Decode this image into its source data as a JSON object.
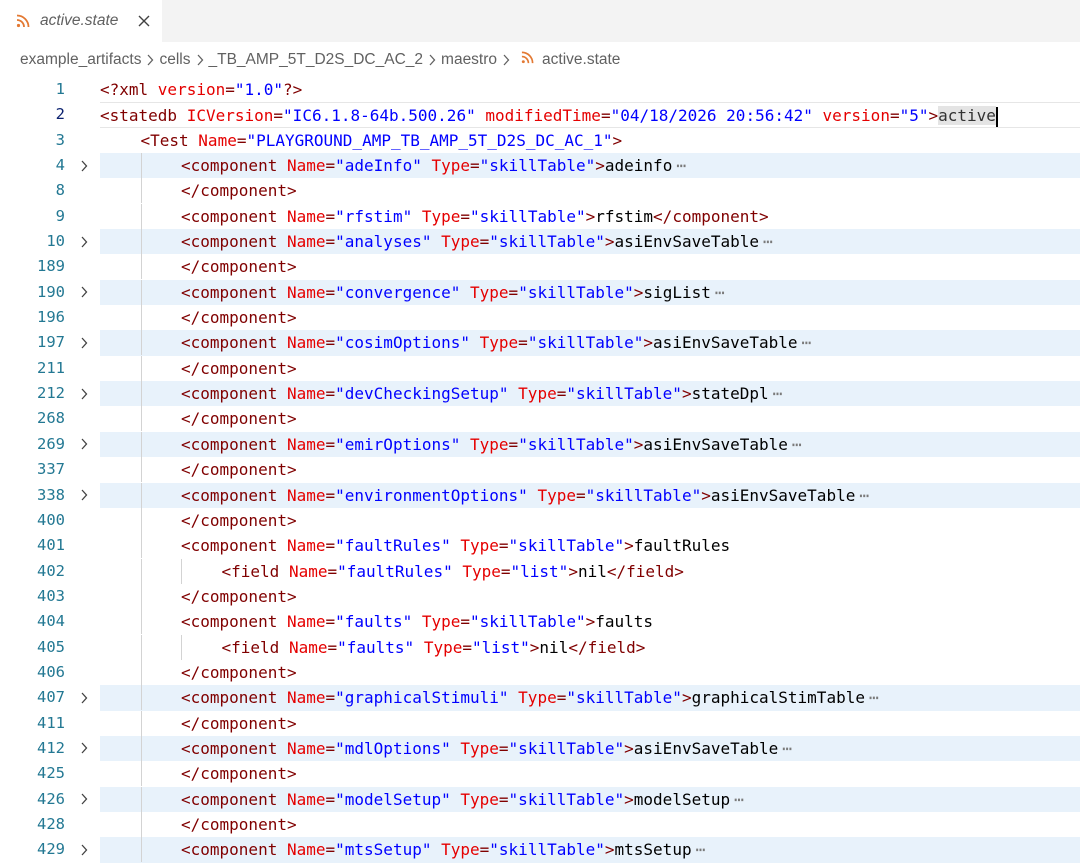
{
  "tab": {
    "title": "active.state"
  },
  "breadcrumb": [
    "example_artifacts",
    "cells",
    "_TB_AMP_5T_D2S_DC_AC_2",
    "maestro",
    "active.state"
  ],
  "colors": {
    "tag": "#800000",
    "attr": "#e50000",
    "value": "#0000ff",
    "text": "#000000",
    "line_number": "#237893",
    "rss": "#e37933"
  },
  "lines": [
    {
      "num": "1",
      "indent": 0,
      "fold": false,
      "tokens": [
        [
          "tag",
          "<?xml "
        ],
        [
          "attr",
          "version"
        ],
        [
          "tag",
          "="
        ],
        [
          "val",
          "\"1.0\""
        ],
        [
          "tag",
          "?>"
        ]
      ]
    },
    {
      "num": "2",
      "indent": 0,
      "fold": false,
      "current": true,
      "tokens": [
        [
          "tag",
          "<statedb "
        ],
        [
          "attr",
          "ICVersion"
        ],
        [
          "tag",
          "="
        ],
        [
          "val",
          "\"IC6.1.8-64b.500.26\""
        ],
        [
          "tag",
          " "
        ],
        [
          "attr",
          "modifiedTime"
        ],
        [
          "tag",
          "="
        ],
        [
          "val",
          "\"04/18/2026 20:56:42\""
        ],
        [
          "tag",
          " "
        ],
        [
          "attr",
          "version"
        ],
        [
          "tag",
          "="
        ],
        [
          "val",
          "\"5\""
        ],
        [
          "tag",
          ">"
        ],
        [
          "sel",
          "active"
        ]
      ]
    },
    {
      "num": "3",
      "indent": 1,
      "fold": false,
      "tokens": [
        [
          "tag",
          "<Test "
        ],
        [
          "attr",
          "Name"
        ],
        [
          "tag",
          "="
        ],
        [
          "val",
          "\"PLAYGROUND_AMP_TB_AMP_5T_D2S_DC_AC_1\""
        ],
        [
          "tag",
          ">"
        ]
      ]
    },
    {
      "num": "4",
      "indent": 2,
      "fold": true,
      "tokens": [
        [
          "tag",
          "<component "
        ],
        [
          "attr",
          "Name"
        ],
        [
          "tag",
          "="
        ],
        [
          "val",
          "\"adeInfo\""
        ],
        [
          "tag",
          " "
        ],
        [
          "attr",
          "Type"
        ],
        [
          "tag",
          "="
        ],
        [
          "val",
          "\"skillTable\""
        ],
        [
          "tag",
          ">"
        ],
        [
          "text",
          "adeinfo"
        ]
      ]
    },
    {
      "num": "8",
      "indent": 2,
      "fold": false,
      "tokens": [
        [
          "tag",
          "</component>"
        ]
      ]
    },
    {
      "num": "9",
      "indent": 2,
      "fold": false,
      "tokens": [
        [
          "tag",
          "<component "
        ],
        [
          "attr",
          "Name"
        ],
        [
          "tag",
          "="
        ],
        [
          "val",
          "\"rfstim\""
        ],
        [
          "tag",
          " "
        ],
        [
          "attr",
          "Type"
        ],
        [
          "tag",
          "="
        ],
        [
          "val",
          "\"skillTable\""
        ],
        [
          "tag",
          ">"
        ],
        [
          "text",
          "rfstim"
        ],
        [
          "tag",
          "</component>"
        ]
      ]
    },
    {
      "num": "10",
      "indent": 2,
      "fold": true,
      "tokens": [
        [
          "tag",
          "<component "
        ],
        [
          "attr",
          "Name"
        ],
        [
          "tag",
          "="
        ],
        [
          "val",
          "\"analyses\""
        ],
        [
          "tag",
          " "
        ],
        [
          "attr",
          "Type"
        ],
        [
          "tag",
          "="
        ],
        [
          "val",
          "\"skillTable\""
        ],
        [
          "tag",
          ">"
        ],
        [
          "text",
          "asiEnvSaveTable"
        ]
      ]
    },
    {
      "num": "189",
      "indent": 2,
      "fold": false,
      "tokens": [
        [
          "tag",
          "</component>"
        ]
      ]
    },
    {
      "num": "190",
      "indent": 2,
      "fold": true,
      "tokens": [
        [
          "tag",
          "<component "
        ],
        [
          "attr",
          "Name"
        ],
        [
          "tag",
          "="
        ],
        [
          "val",
          "\"convergence\""
        ],
        [
          "tag",
          " "
        ],
        [
          "attr",
          "Type"
        ],
        [
          "tag",
          "="
        ],
        [
          "val",
          "\"skillTable\""
        ],
        [
          "tag",
          ">"
        ],
        [
          "text",
          "sigList"
        ]
      ]
    },
    {
      "num": "196",
      "indent": 2,
      "fold": false,
      "tokens": [
        [
          "tag",
          "</component>"
        ]
      ]
    },
    {
      "num": "197",
      "indent": 2,
      "fold": true,
      "tokens": [
        [
          "tag",
          "<component "
        ],
        [
          "attr",
          "Name"
        ],
        [
          "tag",
          "="
        ],
        [
          "val",
          "\"cosimOptions\""
        ],
        [
          "tag",
          " "
        ],
        [
          "attr",
          "Type"
        ],
        [
          "tag",
          "="
        ],
        [
          "val",
          "\"skillTable\""
        ],
        [
          "tag",
          ">"
        ],
        [
          "text",
          "asiEnvSaveTable"
        ]
      ]
    },
    {
      "num": "211",
      "indent": 2,
      "fold": false,
      "tokens": [
        [
          "tag",
          "</component>"
        ]
      ]
    },
    {
      "num": "212",
      "indent": 2,
      "fold": true,
      "tokens": [
        [
          "tag",
          "<component "
        ],
        [
          "attr",
          "Name"
        ],
        [
          "tag",
          "="
        ],
        [
          "val",
          "\"devCheckingSetup\""
        ],
        [
          "tag",
          " "
        ],
        [
          "attr",
          "Type"
        ],
        [
          "tag",
          "="
        ],
        [
          "val",
          "\"skillTable\""
        ],
        [
          "tag",
          ">"
        ],
        [
          "text",
          "stateDpl"
        ]
      ]
    },
    {
      "num": "268",
      "indent": 2,
      "fold": false,
      "tokens": [
        [
          "tag",
          "</component>"
        ]
      ]
    },
    {
      "num": "269",
      "indent": 2,
      "fold": true,
      "tokens": [
        [
          "tag",
          "<component "
        ],
        [
          "attr",
          "Name"
        ],
        [
          "tag",
          "="
        ],
        [
          "val",
          "\"emirOptions\""
        ],
        [
          "tag",
          " "
        ],
        [
          "attr",
          "Type"
        ],
        [
          "tag",
          "="
        ],
        [
          "val",
          "\"skillTable\""
        ],
        [
          "tag",
          ">"
        ],
        [
          "text",
          "asiEnvSaveTable"
        ]
      ]
    },
    {
      "num": "337",
      "indent": 2,
      "fold": false,
      "tokens": [
        [
          "tag",
          "</component>"
        ]
      ]
    },
    {
      "num": "338",
      "indent": 2,
      "fold": true,
      "tokens": [
        [
          "tag",
          "<component "
        ],
        [
          "attr",
          "Name"
        ],
        [
          "tag",
          "="
        ],
        [
          "val",
          "\"environmentOptions\""
        ],
        [
          "tag",
          " "
        ],
        [
          "attr",
          "Type"
        ],
        [
          "tag",
          "="
        ],
        [
          "val",
          "\"skillTable\""
        ],
        [
          "tag",
          ">"
        ],
        [
          "text",
          "asiEnvSaveTable"
        ]
      ]
    },
    {
      "num": "400",
      "indent": 2,
      "fold": false,
      "tokens": [
        [
          "tag",
          "</component>"
        ]
      ]
    },
    {
      "num": "401",
      "indent": 2,
      "fold": false,
      "tokens": [
        [
          "tag",
          "<component "
        ],
        [
          "attr",
          "Name"
        ],
        [
          "tag",
          "="
        ],
        [
          "val",
          "\"faultRules\""
        ],
        [
          "tag",
          " "
        ],
        [
          "attr",
          "Type"
        ],
        [
          "tag",
          "="
        ],
        [
          "val",
          "\"skillTable\""
        ],
        [
          "tag",
          ">"
        ],
        [
          "text",
          "faultRules"
        ]
      ]
    },
    {
      "num": "402",
      "indent": 3,
      "fold": false,
      "tokens": [
        [
          "tag",
          "<field "
        ],
        [
          "attr",
          "Name"
        ],
        [
          "tag",
          "="
        ],
        [
          "val",
          "\"faultRules\""
        ],
        [
          "tag",
          " "
        ],
        [
          "attr",
          "Type"
        ],
        [
          "tag",
          "="
        ],
        [
          "val",
          "\"list\""
        ],
        [
          "tag",
          ">"
        ],
        [
          "text",
          "nil"
        ],
        [
          "tag",
          "</field>"
        ]
      ]
    },
    {
      "num": "403",
      "indent": 2,
      "fold": false,
      "tokens": [
        [
          "tag",
          "</component>"
        ]
      ]
    },
    {
      "num": "404",
      "indent": 2,
      "fold": false,
      "tokens": [
        [
          "tag",
          "<component "
        ],
        [
          "attr",
          "Name"
        ],
        [
          "tag",
          "="
        ],
        [
          "val",
          "\"faults\""
        ],
        [
          "tag",
          " "
        ],
        [
          "attr",
          "Type"
        ],
        [
          "tag",
          "="
        ],
        [
          "val",
          "\"skillTable\""
        ],
        [
          "tag",
          ">"
        ],
        [
          "text",
          "faults"
        ]
      ]
    },
    {
      "num": "405",
      "indent": 3,
      "fold": false,
      "tokens": [
        [
          "tag",
          "<field "
        ],
        [
          "attr",
          "Name"
        ],
        [
          "tag",
          "="
        ],
        [
          "val",
          "\"faults\""
        ],
        [
          "tag",
          " "
        ],
        [
          "attr",
          "Type"
        ],
        [
          "tag",
          "="
        ],
        [
          "val",
          "\"list\""
        ],
        [
          "tag",
          ">"
        ],
        [
          "text",
          "nil"
        ],
        [
          "tag",
          "</field>"
        ]
      ]
    },
    {
      "num": "406",
      "indent": 2,
      "fold": false,
      "tokens": [
        [
          "tag",
          "</component>"
        ]
      ]
    },
    {
      "num": "407",
      "indent": 2,
      "fold": true,
      "tokens": [
        [
          "tag",
          "<component "
        ],
        [
          "attr",
          "Name"
        ],
        [
          "tag",
          "="
        ],
        [
          "val",
          "\"graphicalStimuli\""
        ],
        [
          "tag",
          " "
        ],
        [
          "attr",
          "Type"
        ],
        [
          "tag",
          "="
        ],
        [
          "val",
          "\"skillTable\""
        ],
        [
          "tag",
          ">"
        ],
        [
          "text",
          "graphicalStimTable"
        ]
      ]
    },
    {
      "num": "411",
      "indent": 2,
      "fold": false,
      "tokens": [
        [
          "tag",
          "</component>"
        ]
      ]
    },
    {
      "num": "412",
      "indent": 2,
      "fold": true,
      "tokens": [
        [
          "tag",
          "<component "
        ],
        [
          "attr",
          "Name"
        ],
        [
          "tag",
          "="
        ],
        [
          "val",
          "\"mdlOptions\""
        ],
        [
          "tag",
          " "
        ],
        [
          "attr",
          "Type"
        ],
        [
          "tag",
          "="
        ],
        [
          "val",
          "\"skillTable\""
        ],
        [
          "tag",
          ">"
        ],
        [
          "text",
          "asiEnvSaveTable"
        ]
      ]
    },
    {
      "num": "425",
      "indent": 2,
      "fold": false,
      "tokens": [
        [
          "tag",
          "</component>"
        ]
      ]
    },
    {
      "num": "426",
      "indent": 2,
      "fold": true,
      "tokens": [
        [
          "tag",
          "<component "
        ],
        [
          "attr",
          "Name"
        ],
        [
          "tag",
          "="
        ],
        [
          "val",
          "\"modelSetup\""
        ],
        [
          "tag",
          " "
        ],
        [
          "attr",
          "Type"
        ],
        [
          "tag",
          "="
        ],
        [
          "val",
          "\"skillTable\""
        ],
        [
          "tag",
          ">"
        ],
        [
          "text",
          "modelSetup"
        ]
      ]
    },
    {
      "num": "428",
      "indent": 2,
      "fold": false,
      "tokens": [
        [
          "tag",
          "</component>"
        ]
      ]
    },
    {
      "num": "429",
      "indent": 2,
      "fold": true,
      "tokens": [
        [
          "tag",
          "<component "
        ],
        [
          "attr",
          "Name"
        ],
        [
          "tag",
          "="
        ],
        [
          "val",
          "\"mtsSetup\""
        ],
        [
          "tag",
          " "
        ],
        [
          "attr",
          "Type"
        ],
        [
          "tag",
          "="
        ],
        [
          "val",
          "\"skillTable\""
        ],
        [
          "tag",
          ">"
        ],
        [
          "text",
          "mtsSetup"
        ]
      ]
    }
  ]
}
